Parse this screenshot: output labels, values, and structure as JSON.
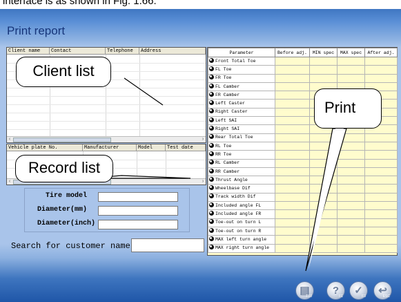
{
  "caption": "interface is as shown in Fig. 1.66.",
  "window_title": "Print report",
  "client_list": {
    "columns": [
      "Client name",
      "Contact",
      "Telephone",
      "Address"
    ]
  },
  "record_list": {
    "columns": [
      "Vehicle plate No.",
      "Manufacturer",
      "Model",
      "Test date"
    ]
  },
  "callouts": {
    "client": "Client list",
    "record": "Record list",
    "print": "Print"
  },
  "tire_form": {
    "model_label": "Tire model",
    "model_value": "",
    "diameter_mm_label": "Diameter(mm)",
    "diameter_mm_value": "",
    "diameter_inch_label": "Diameter(inch)",
    "diameter_inch_value": ""
  },
  "search": {
    "label": "Search for customer name",
    "value": ""
  },
  "param_table": {
    "columns": [
      "Parameter",
      "Before adj.",
      "MIN spec",
      "MAX spec",
      "After adj."
    ],
    "rows": [
      "Front Total Toe",
      "FL Toe",
      "FR Toe",
      "FL Camber",
      "FR Camber",
      "Left Caster",
      "Right Caster",
      "Left SAI",
      "Right SAI",
      "Rear Total Toe",
      "RL Toe",
      "RR Toe",
      "RL Camber",
      "RR Camber",
      "Thrust Angle",
      "Wheelbase Dif",
      "Track width Dif",
      "Included angle FL",
      "Included angle FR",
      "Toe-out on turn L",
      "Toe-out on turn R",
      "MAX left turn angle",
      "MAX right turn angle"
    ]
  },
  "buttons": [
    {
      "name": "print-button",
      "icon": "printer-icon",
      "key": "F10"
    },
    {
      "name": "help-button",
      "icon": "question-icon",
      "key": "F1"
    },
    {
      "name": "confirm-button",
      "icon": "checkmark-icon",
      "key": "F3"
    },
    {
      "name": "exit-button",
      "icon": "back-arrow-icon",
      "key": "ESC"
    }
  ]
}
